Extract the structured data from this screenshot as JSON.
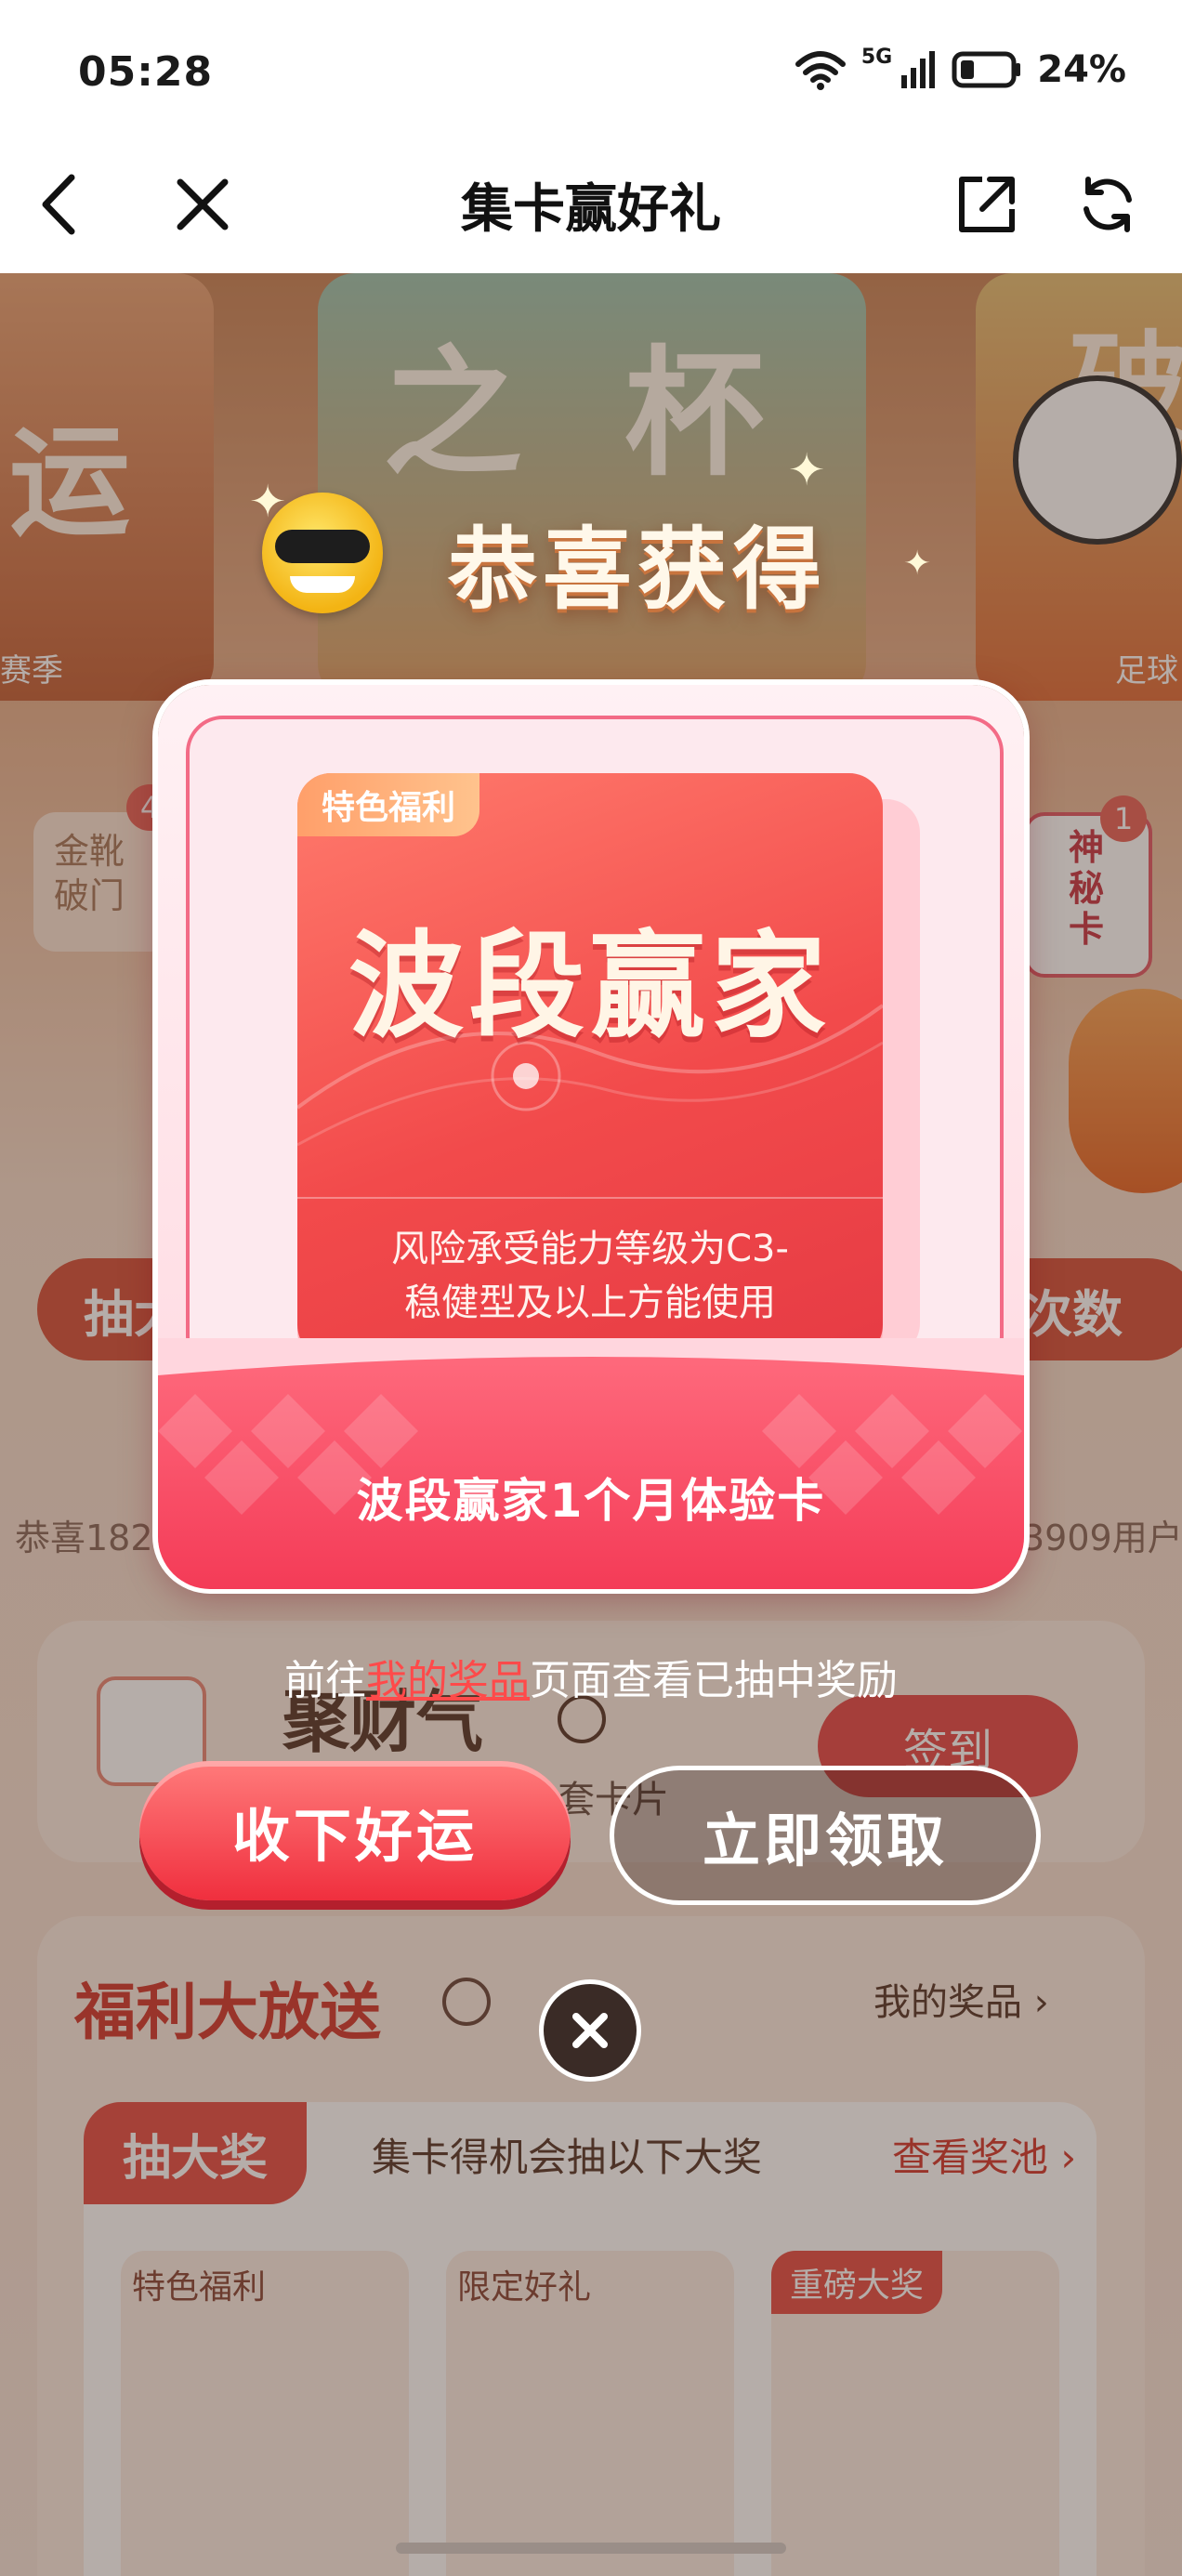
{
  "status_bar": {
    "time": "05:28",
    "network": "5G",
    "battery": "24%"
  },
  "nav": {
    "title": "集卡赢好礼",
    "back_icon": "chevron-left-icon",
    "close_icon": "close-icon",
    "share_icon": "share-icon",
    "refresh_icon": "refresh-icon"
  },
  "background": {
    "tile_left_word": "运",
    "tile_left_caption": "赛季",
    "tile_center_words": [
      "之",
      "杯"
    ],
    "tile_right_word": "破",
    "tile_right_caption": "足球",
    "card_left": {
      "count": "4",
      "label_line1": "金靴",
      "label_line2": "破门"
    },
    "card_right": {
      "count": "1",
      "label": "神秘卡"
    },
    "button_left": "抽大",
    "button_right": "次数",
    "ticker_left": "恭喜182*",
    "ticker_right": "3909用户",
    "section_title": "聚财气",
    "section_sub": "套卡片",
    "signin_label": "签到",
    "benefits_title": "福利大放送",
    "my_prizes": "我的奖品 ›",
    "draw_tab": "抽大奖",
    "draw_desc": "集卡得机会抽以下大奖",
    "prize_pool": "查看奖池 ›",
    "prize_tags": [
      "特色福利",
      "限定好礼",
      "重磅大奖"
    ]
  },
  "popup": {
    "heading": "恭喜获得",
    "badge": "特色福利",
    "card_title": "波段赢家",
    "card_desc_line1": "风险承受能力等级为C3-",
    "card_desc_line2": "稳健型及以上方能使用",
    "reward_name": "波段赢家1个月体验卡",
    "goto_prefix": "前往",
    "goto_link": "我的奖品",
    "goto_suffix": "页面查看已抽中奖励",
    "btn_accept": "收下好运",
    "btn_claim": "立即领取",
    "close_icon": "close-circle-icon"
  },
  "colors": {
    "accent_red": "#f24a4b",
    "link_red": "#ff4a4a",
    "badge_orange": "#ffb07a"
  }
}
